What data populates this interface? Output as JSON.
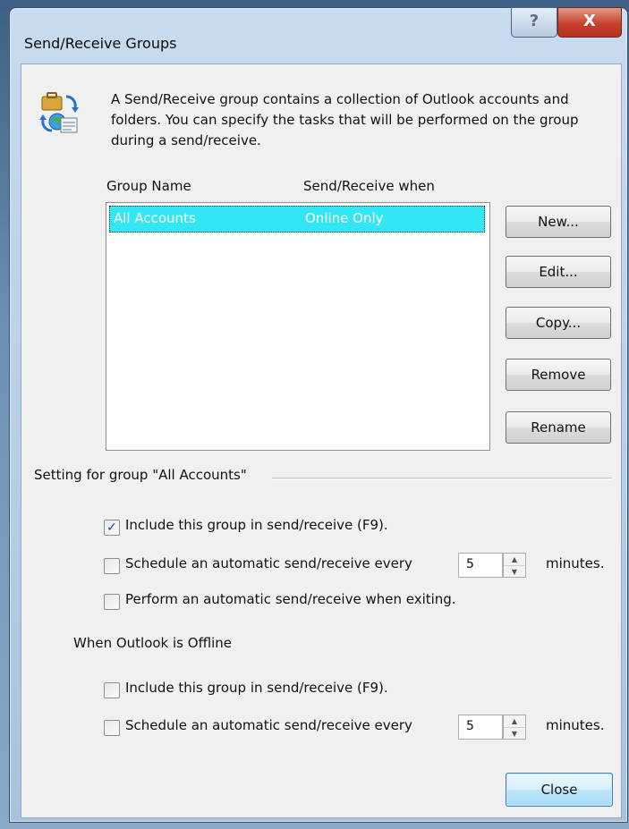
{
  "window": {
    "title": "Send/Receive Groups",
    "help_glyph": "?",
    "close_glyph": "X"
  },
  "intro": {
    "icon": "send-receive-groups-icon",
    "text": "A Send/Receive group contains a collection of Outlook accounts and folders. You can specify the tasks that will be performed on the group during a send/receive."
  },
  "groups": {
    "col_name": "Group Name",
    "col_when": "Send/Receive when",
    "rows": [
      {
        "name": "All Accounts",
        "when": "Online Only",
        "selected": true
      }
    ]
  },
  "buttons": {
    "new": "New...",
    "edit": "Edit...",
    "copy": "Copy...",
    "remove": "Remove",
    "rename": "Rename",
    "close": "Close"
  },
  "settings": {
    "section_label": "Setting for group \"All Accounts\"",
    "online": {
      "include_label": "Include this group in send/receive (F9).",
      "include_checked": true,
      "schedule_label": "Schedule an automatic send/receive every",
      "schedule_checked": false,
      "schedule_minutes": "5",
      "minutes_label": "minutes.",
      "exit_label": "Perform an automatic send/receive when exiting.",
      "exit_checked": false
    },
    "offline": {
      "section_label": "When Outlook is Offline",
      "include_label": "Include this group in send/receive (F9).",
      "include_checked": false,
      "schedule_label": "Schedule an automatic send/receive every",
      "schedule_checked": false,
      "schedule_minutes": "5",
      "minutes_label": "minutes."
    }
  },
  "glyphs": {
    "check": "✓",
    "spin_up": "▲",
    "spin_down": "▼"
  },
  "colors": {
    "selection": "#33e6f4",
    "close_button": "#c8402c"
  }
}
